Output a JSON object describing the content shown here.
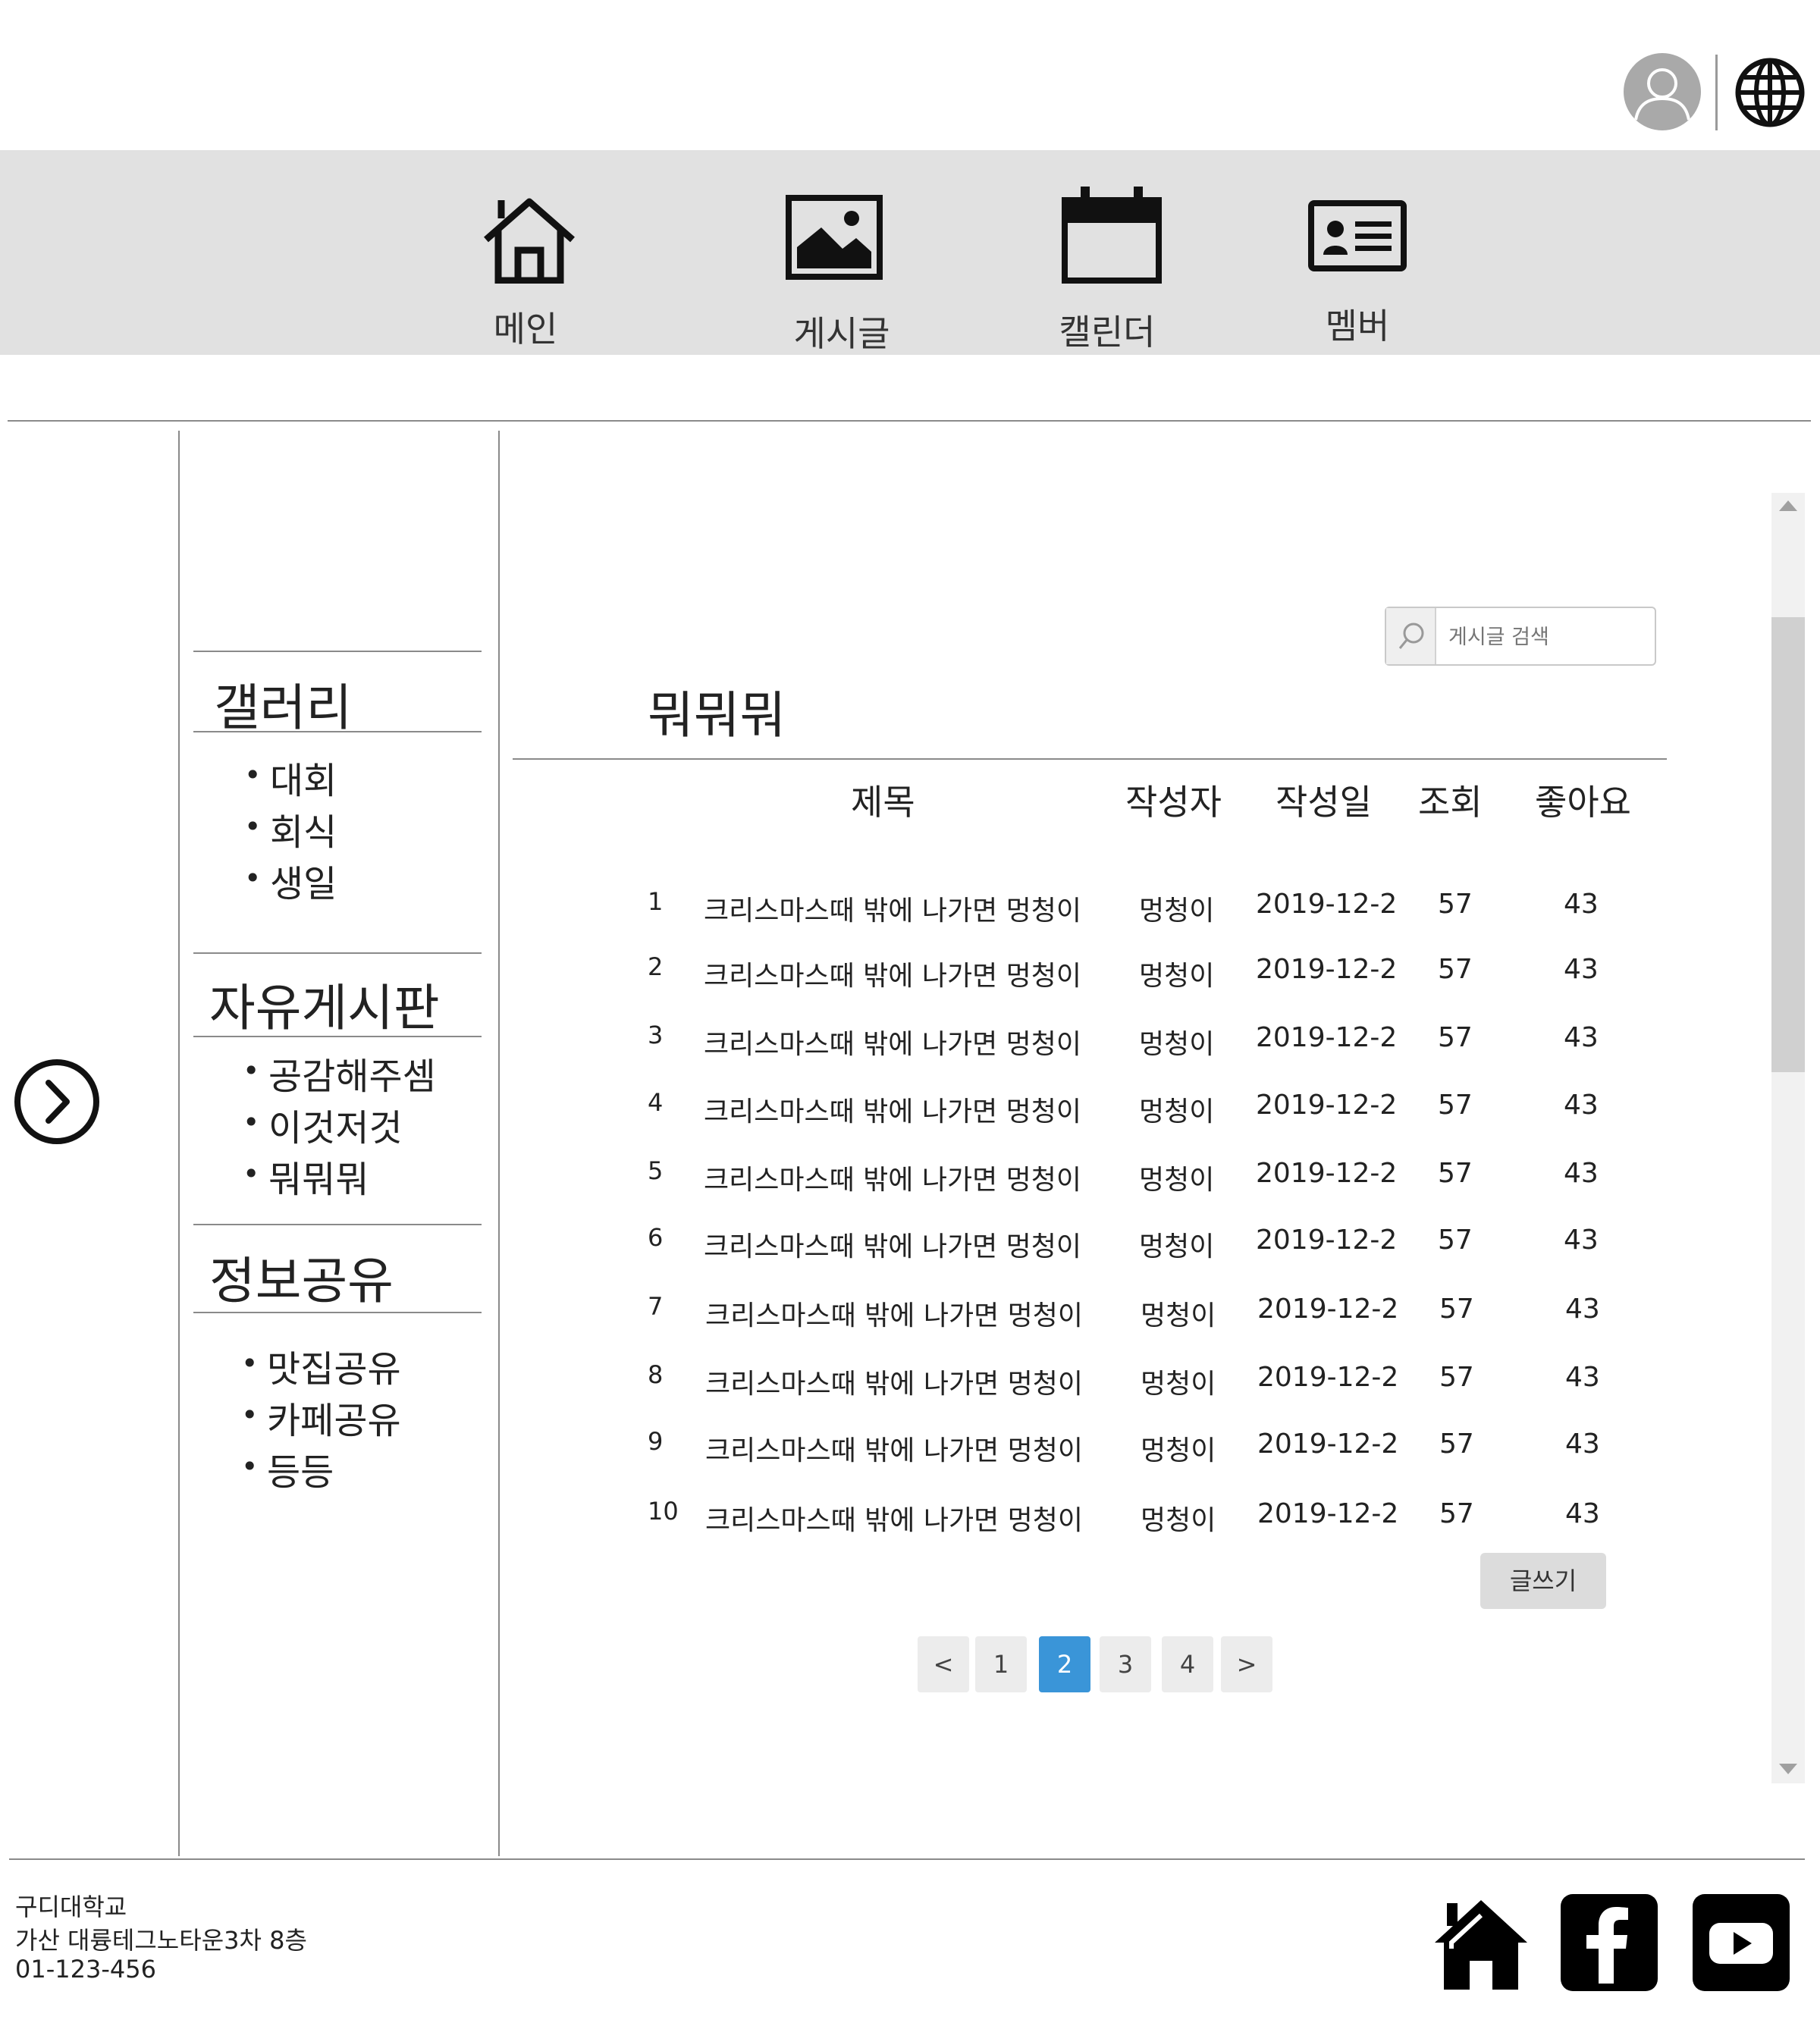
{
  "nav": {
    "items": [
      {
        "label": "메인",
        "icon": "home-icon"
      },
      {
        "label": "게시글",
        "icon": "image-icon"
      },
      {
        "label": "캘린더",
        "icon": "calendar-icon"
      },
      {
        "label": "멤버",
        "icon": "id-card-icon"
      }
    ]
  },
  "sidebar": {
    "categories": [
      {
        "title": "갤러리",
        "items": [
          "대회",
          "회식",
          "생일"
        ]
      },
      {
        "title": "자유게시판",
        "items": [
          "공감해주셈",
          "이것저것",
          "뭐뭐뭐"
        ]
      },
      {
        "title": "정보공유",
        "items": [
          "맛집공유",
          "카페공유",
          "등등"
        ]
      }
    ]
  },
  "search": {
    "placeholder": "게시글 검색"
  },
  "board": {
    "title": "뭐뭐뭐",
    "columns": [
      "제목",
      "작성자",
      "작성일",
      "조회",
      "좋아요"
    ],
    "rows": [
      {
        "no": "1",
        "title": "크리스마스때 밖에 나가면 멍청이",
        "author": "멍청이",
        "date": "2019-12-2",
        "views": "57",
        "likes": "43"
      },
      {
        "no": "2",
        "title": "크리스마스때 밖에 나가면 멍청이",
        "author": "멍청이",
        "date": "2019-12-2",
        "views": "57",
        "likes": "43"
      },
      {
        "no": "3",
        "title": "크리스마스때 밖에 나가면 멍청이",
        "author": "멍청이",
        "date": "2019-12-2",
        "views": "57",
        "likes": "43"
      },
      {
        "no": "4",
        "title": "크리스마스때 밖에 나가면 멍청이",
        "author": "멍청이",
        "date": "2019-12-2",
        "views": "57",
        "likes": "43"
      },
      {
        "no": "5",
        "title": "크리스마스때 밖에 나가면 멍청이",
        "author": "멍청이",
        "date": "2019-12-2",
        "views": "57",
        "likes": "43"
      },
      {
        "no": "6",
        "title": "크리스마스때 밖에 나가면 멍청이",
        "author": "멍청이",
        "date": "2019-12-2",
        "views": "57",
        "likes": "43"
      },
      {
        "no": "7",
        "title": "크리스마스때 밖에 나가면 멍청이",
        "author": "멍청이",
        "date": "2019-12-2",
        "views": "57",
        "likes": "43"
      },
      {
        "no": "8",
        "title": "크리스마스때 밖에 나가면 멍청이",
        "author": "멍청이",
        "date": "2019-12-2",
        "views": "57",
        "likes": "43"
      },
      {
        "no": "9",
        "title": "크리스마스때 밖에 나가면 멍청이",
        "author": "멍청이",
        "date": "2019-12-2",
        "views": "57",
        "likes": "43"
      },
      {
        "no": "10",
        "title": "크리스마스때 밖에 나가면 멍청이",
        "author": "멍청이",
        "date": "2019-12-2",
        "views": "57",
        "likes": "43"
      }
    ],
    "write_label": "글쓰기"
  },
  "pagination": {
    "prev": "<",
    "pages": [
      "1",
      "2",
      "3",
      "4"
    ],
    "current": "2",
    "next": ">"
  },
  "footer": {
    "lines": [
      "구디대학교",
      "가산 대륭테그노타운3차 8층",
      "01-123-456"
    ],
    "social_icons": [
      "home-icon",
      "facebook-icon",
      "youtube-icon"
    ]
  },
  "colors": {
    "nav_bg": "#e1e1e1",
    "active_page": "#3a95d8",
    "scrollbar_track": "#f1f1f1",
    "scrollbar_thumb": "#d0d0d0"
  }
}
